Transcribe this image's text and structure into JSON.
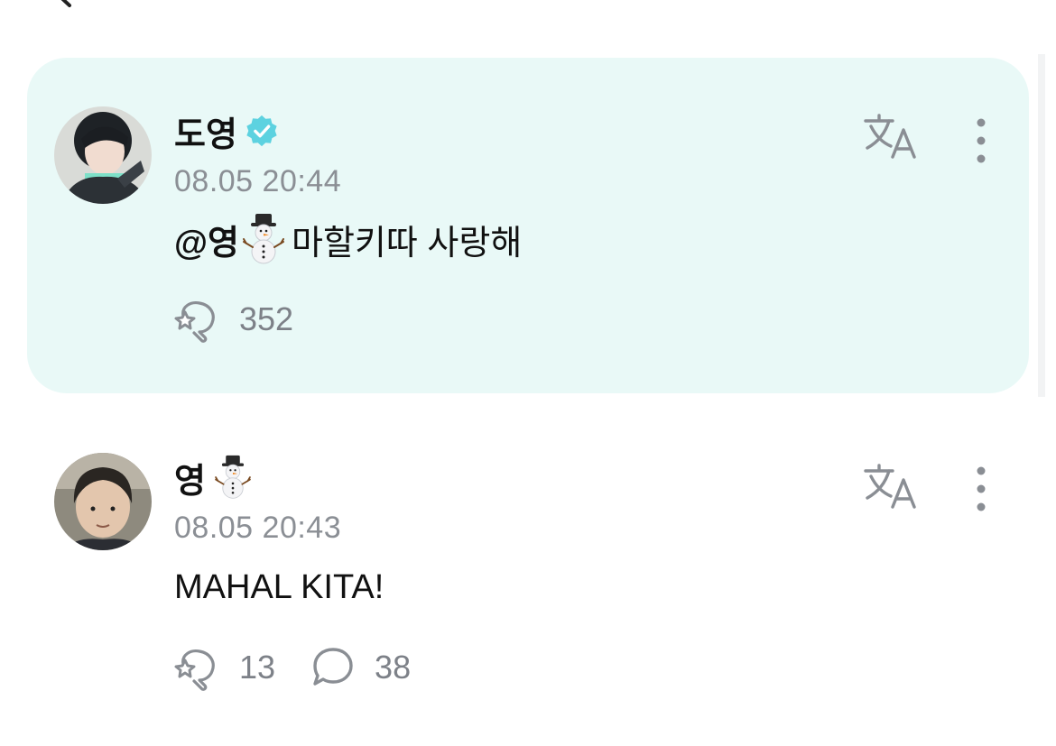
{
  "header": {
    "title": "",
    "back_icon": "back-arrow-icon"
  },
  "posts": [
    {
      "author": "도영",
      "verified": true,
      "timestamp": "08.05 20:44",
      "mention": "@영",
      "text": "마할키따 사랑해",
      "reactions": "352",
      "highlighted": true,
      "background": "#e9f9f7",
      "accent": "#5dd2e0"
    },
    {
      "author": "영",
      "timestamp": "08.05 20:43",
      "text": "MAHAL KITA!",
      "reactions": "13",
      "comments": "38",
      "highlighted": false
    }
  ]
}
